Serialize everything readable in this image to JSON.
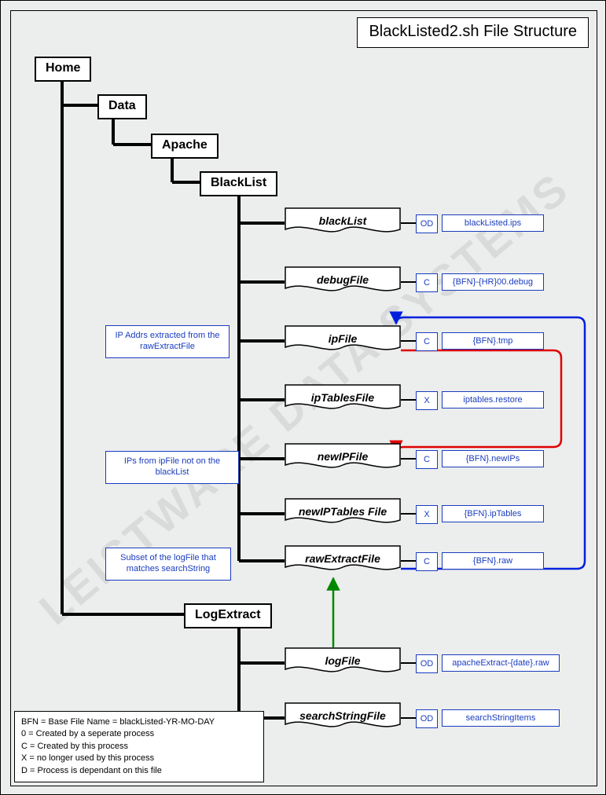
{
  "title": "BlackListed2.sh File Structure",
  "watermark": "LEISTWARE DATA SYSTEMS",
  "folders": {
    "home": "Home",
    "data": "Data",
    "apache": "Apache",
    "blacklist": "BlackList",
    "logextract": "LogExtract"
  },
  "files": {
    "blackList": {
      "label": "blackList",
      "code": "OD",
      "name": "blackListed.ips"
    },
    "debugFile": {
      "label": "debugFile",
      "code": "C",
      "name": "{BFN}-{HR}00.debug"
    },
    "ipFile": {
      "label": "ipFile",
      "code": "C",
      "name": "{BFN}.tmp"
    },
    "ipTablesFile": {
      "label": "ipTablesFile",
      "code": "X",
      "name": "iptables.restore"
    },
    "newIPFile": {
      "label": "newIPFile",
      "code": "C",
      "name": "{BFN}.newIPs"
    },
    "newIPTablesFile": {
      "label": "newIPTables File",
      "code": "X",
      "name": "{BFN}.ipTables"
    },
    "rawExtractFile": {
      "label": "rawExtractFile",
      "code": "C",
      "name": "{BFN}.raw"
    },
    "logFile": {
      "label": "logFile",
      "code": "OD",
      "name": "apacheExtract-{date}.raw"
    },
    "searchStringFile": {
      "label": "searchStringFile",
      "code": "OD",
      "name": "searchStringItems"
    }
  },
  "notes": {
    "ipFile": "IP Addrs extracted from the rawExtractFile",
    "newIPFile": "IPs from  ipFile not on the blackList",
    "rawExtractFile": "Subset of the  logFile that matches searchString"
  },
  "flows": [
    {
      "from": "rawExtractFile",
      "to": "ipFile",
      "color": "blue",
      "meaning": "IPs extracted from rawExtractFile feed ipFile"
    },
    {
      "from": "ipFile",
      "to": "newIPFile",
      "color": "red",
      "meaning": "IPs from ipFile not on blackList become newIPFile"
    },
    {
      "from": "logFile",
      "to": "rawExtractFile",
      "color": "green",
      "meaning": "logFile filtered by searchString produces rawExtractFile"
    }
  ],
  "legend": {
    "bfn": "BFN = Base File Name = blackListed-YR-MO-DAY",
    "o": "0 = Created by a seperate process",
    "c": "C = Created by this process",
    "x": "X = no longer used by this process",
    "d": "D = Process is dependant on this file"
  }
}
